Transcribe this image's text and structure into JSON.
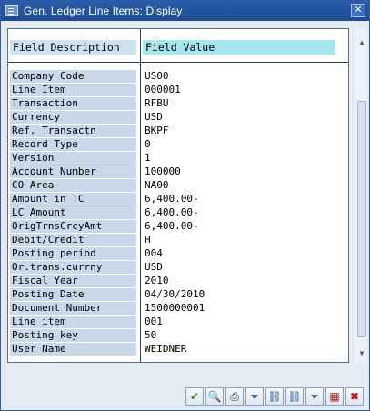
{
  "window": {
    "title": "Gen. Ledger Line Items: Display"
  },
  "table": {
    "header": {
      "description": "Field Description",
      "value": "Field Value"
    },
    "rows": [
      {
        "label": "Company Code",
        "value": "US00"
      },
      {
        "label": "Line Item",
        "value": "000001"
      },
      {
        "label": "Transaction",
        "value": "RFBU"
      },
      {
        "label": "Currency",
        "value": "USD"
      },
      {
        "label": "Ref. Transactn",
        "value": "BKPF"
      },
      {
        "label": "Record Type",
        "value": "0"
      },
      {
        "label": "Version",
        "value": "1"
      },
      {
        "label": "Account Number",
        "value": "100000"
      },
      {
        "label": "CO Area",
        "value": "NA00"
      },
      {
        "label": "Amount in TC",
        "value": "6,400.00-"
      },
      {
        "label": "LC Amount",
        "value": "6,400.00-"
      },
      {
        "label": "OrigTrnsCrcyAmt",
        "value": "6,400.00-"
      },
      {
        "label": "Debit/Credit",
        "value": "H"
      },
      {
        "label": "Posting period",
        "value": "004"
      },
      {
        "label": "Or.trans.currny",
        "value": "USD"
      },
      {
        "label": "Fiscal Year",
        "value": "2010"
      },
      {
        "label": "Posting Date",
        "value": "04/30/2010"
      },
      {
        "label": "Document Number",
        "value": "1500000001"
      },
      {
        "label": "Line item",
        "value": "001"
      },
      {
        "label": "Posting key",
        "value": "50"
      },
      {
        "label": "User Name",
        "value": "WEIDNER"
      }
    ]
  },
  "toolbar": {
    "buttons": [
      {
        "icon": "check-icon",
        "glyph": "✔",
        "color": "#3a8f1f"
      },
      {
        "icon": "details-icon",
        "glyph": "🔍",
        "color": "#1f4f9a"
      },
      {
        "icon": "print-icon",
        "glyph": "⎙",
        "color": "#333333"
      },
      {
        "icon": "sort-icon",
        "glyph": "⏷",
        "color": "#1f4f9a"
      },
      {
        "icon": "find-icon",
        "glyph": "⛓",
        "color": "#1f4f9a"
      },
      {
        "icon": "find-next-icon",
        "glyph": "⛓",
        "color": "#1f4f9a"
      },
      {
        "icon": "filter-icon",
        "glyph": "⏷",
        "color": "#1f4f9a"
      },
      {
        "icon": "grid-icon",
        "glyph": "▦",
        "color": "#b02020"
      },
      {
        "icon": "cancel-icon",
        "glyph": "✖",
        "color": "#cc1010"
      }
    ]
  }
}
